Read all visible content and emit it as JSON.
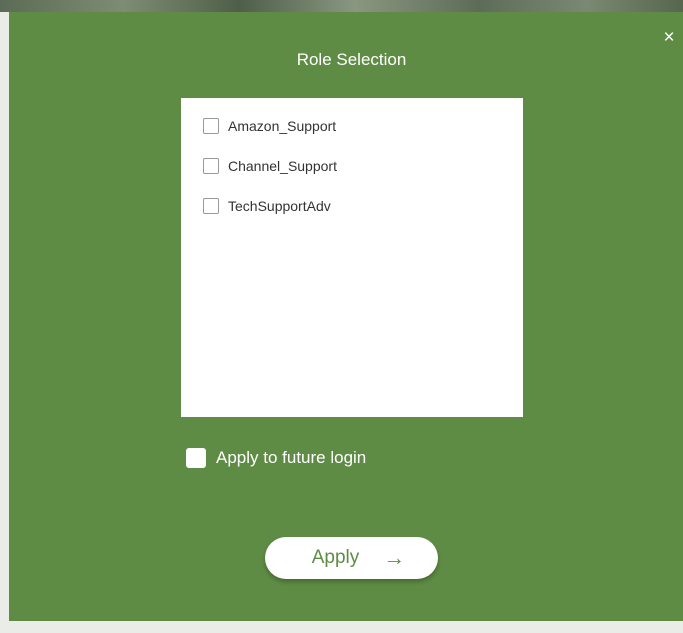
{
  "dialog": {
    "title": "Role Selection",
    "close_label": "×",
    "background_color": "#5f8c44"
  },
  "roles": [
    {
      "label": "Amazon_Support",
      "checked": false
    },
    {
      "label": "Channel_Support",
      "checked": false
    },
    {
      "label": "TechSupportAdv",
      "checked": false
    }
  ],
  "future_login": {
    "label": "Apply to future login",
    "checked": false
  },
  "apply_button": {
    "label": "Apply",
    "icon": "arrow-right-icon",
    "arrow": "→"
  }
}
